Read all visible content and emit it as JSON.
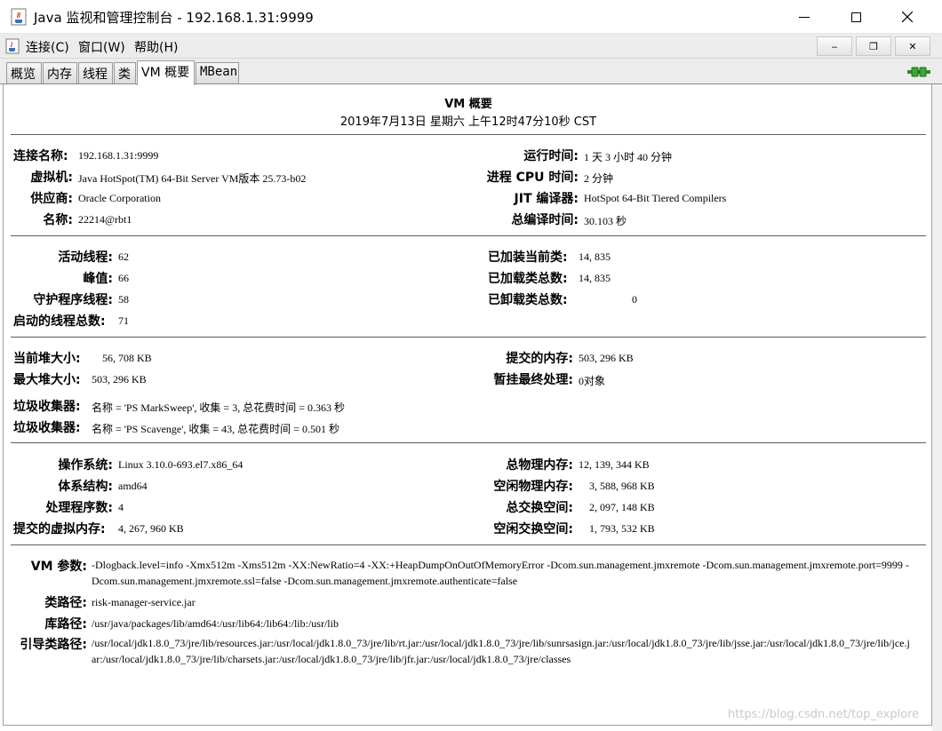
{
  "window": {
    "title": "Java 监视和管理控制台 - 192.168.1.31:9999"
  },
  "menu": {
    "connect": "连接(C)",
    "window": "窗口(W)",
    "help": "帮助(H)",
    "min_symbol": "‒",
    "restore_symbol": "❐",
    "close_symbol": "✕"
  },
  "tabs": [
    {
      "label": "概览"
    },
    {
      "label": "内存"
    },
    {
      "label": "线程"
    },
    {
      "label": "类"
    },
    {
      "label": "VM 概要"
    },
    {
      "label": "MBean"
    }
  ],
  "active_tab": "VM 概要",
  "summary": {
    "title": "VM 概要",
    "date": "2019年7月13日 星期六 上午12时47分10秒 CST",
    "section1": {
      "connection_name_label": "连接名称:",
      "connection_name": "192.168.1.31:9999",
      "vm_label": "虚拟机:",
      "vm": "Java HotSpot(TM) 64-Bit Server VM版本 25.73-b02",
      "vendor_label": "供应商:",
      "vendor": "Oracle Corporation",
      "name_label": "名称:",
      "name": "22214@rbt1",
      "uptime_label": "运行时间:",
      "uptime": "1 天 3 小时 40 分钟",
      "process_cpu_label": "进程 CPU 时间:",
      "process_cpu": "2 分钟",
      "jit_label": "JIT 编译器:",
      "jit": "HotSpot 64-Bit Tiered Compilers",
      "compile_time_label": "总编译时间:",
      "compile_time": "30.103 秒"
    },
    "section2": {
      "live_threads_label": "活动线程:",
      "live_threads": "62",
      "peak_label": "峰值:",
      "peak": "66",
      "daemon_label": "守护程序线程:",
      "daemon": "58",
      "started_label": "启动的线程总数:",
      "started": "71",
      "loaded_label": "已加装当前类:",
      "loaded": "14, 835",
      "total_loaded_label": "已加载类总数:",
      "total_loaded": "14, 835",
      "unloaded_label": "已卸载类总数:",
      "unloaded": "0"
    },
    "section3": {
      "heap_size_label": "当前堆大小:",
      "heap_size": "56, 708 KB",
      "max_heap_label": "最大堆大小:",
      "max_heap": "503, 296 KB",
      "committed_label": "提交的内存:",
      "committed": "503, 296 KB",
      "pending_label": "暂挂最终处理:",
      "pending": "0对象",
      "gc1_label": "垃圾收集器:",
      "gc1": "名称 = 'PS MarkSweep', 收集 = 3, 总花费时间 = 0.363 秒",
      "gc2_label": "垃圾收集器:",
      "gc2": "名称 = 'PS Scavenge', 收集 = 43, 总花费时间 = 0.501 秒"
    },
    "section4": {
      "os_label": "操作系统:",
      "os": "Linux 3.10.0-693.el7.x86_64",
      "arch_label": "体系结构:",
      "arch": "amd64",
      "processors_label": "处理程序数:",
      "processors": "4",
      "committed_virtual_label": "提交的虚拟内存:",
      "committed_virtual": "4, 267, 960 KB",
      "total_physical_label": "总物理内存:",
      "total_physical": "12, 139, 344 KB",
      "free_physical_label": "空闲物理内存:",
      "free_physical": "3, 588, 968 KB",
      "total_swap_label": "总交换空间:",
      "total_swap": "2, 097, 148 KB",
      "free_swap_label": "空闲交换空间:",
      "free_swap": "1, 793, 532 KB"
    },
    "section5": {
      "vm_args_label": "VM 参数:",
      "vm_args": "-Dlogback.level=info -Xmx512m -Xms512m -XX:NewRatio=4 -XX:+HeapDumpOnOutOfMemoryError -Dcom.sun.management.jmxremote -Dcom.sun.management.jmxremote.port=9999 -Dcom.sun.management.jmxremote.ssl=false -Dcom.sun.management.jmxremote.authenticate=false",
      "class_path_label": "类路径:",
      "class_path": "risk-manager-service.jar",
      "library_path_label": "库路径:",
      "library_path": "/usr/java/packages/lib/amd64:/usr/lib64:/lib64:/lib:/usr/lib",
      "boot_class_path_label": "引导类路径:",
      "boot_class_path": "/usr/local/jdk1.8.0_73/jre/lib/resources.jar:/usr/local/jdk1.8.0_73/jre/lib/rt.jar:/usr/local/jdk1.8.0_73/jre/lib/sunrsasign.jar:/usr/local/jdk1.8.0_73/jre/lib/jsse.jar:/usr/local/jdk1.8.0_73/jre/lib/jce.jar:/usr/local/jdk1.8.0_73/jre/lib/charsets.jar:/usr/local/jdk1.8.0_73/jre/lib/jfr.jar:/usr/local/jdk1.8.0_73/jre/classes"
    }
  },
  "watermark": "https://blog.csdn.net/top_explore",
  "colors": {
    "connected_icon": "#3aa63a",
    "tab_border": "#9a9a9a",
    "separator": "#5c5c5c"
  },
  "icons": {
    "app": "java-cup-icon",
    "connection": "connected-plug-icon"
  }
}
